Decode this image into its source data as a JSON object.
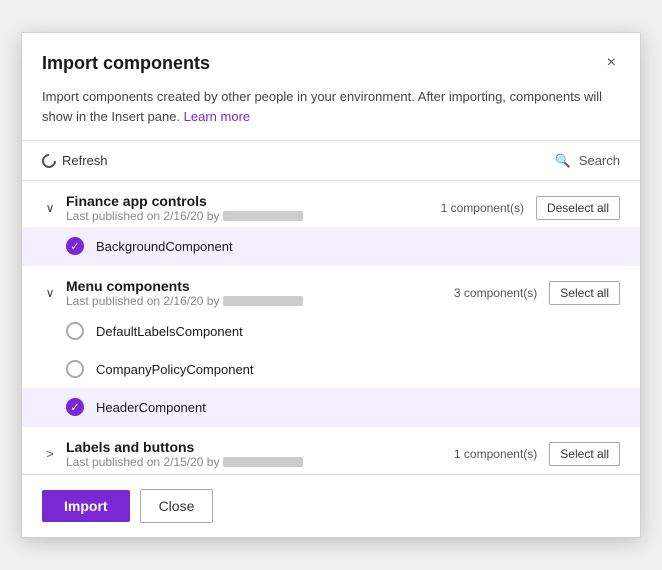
{
  "modal": {
    "title": "Import components",
    "description": "Import components created by other people in your environment. After importing, components will show in the Insert pane.",
    "learn_more_label": "Learn more",
    "close_label": "×"
  },
  "toolbar": {
    "refresh_label": "Refresh",
    "search_label": "Search"
  },
  "sections": [
    {
      "id": "finance",
      "title": "Finance app controls",
      "subtitle": "Last published on 2/16/20 by",
      "component_count": "1 component(s)",
      "action_label": "Deselect all",
      "chevron": "∨",
      "expanded": true,
      "components": [
        {
          "name": "BackgroundComponent",
          "selected": true
        }
      ]
    },
    {
      "id": "menu",
      "title": "Menu components",
      "subtitle": "Last published on 2/16/20 by",
      "component_count": "3 component(s)",
      "action_label": "Select all",
      "chevron": "∨",
      "expanded": true,
      "components": [
        {
          "name": "DefaultLabelsComponent",
          "selected": false
        },
        {
          "name": "CompanyPolicyComponent",
          "selected": false
        },
        {
          "name": "HeaderComponent",
          "selected": true
        }
      ]
    },
    {
      "id": "labels",
      "title": "Labels and buttons",
      "subtitle": "Last published on 2/15/20 by",
      "component_count": "1 component(s)",
      "action_label": "Select all",
      "chevron": ">",
      "expanded": false,
      "components": []
    }
  ],
  "footer": {
    "import_label": "Import",
    "close_label": "Close"
  }
}
